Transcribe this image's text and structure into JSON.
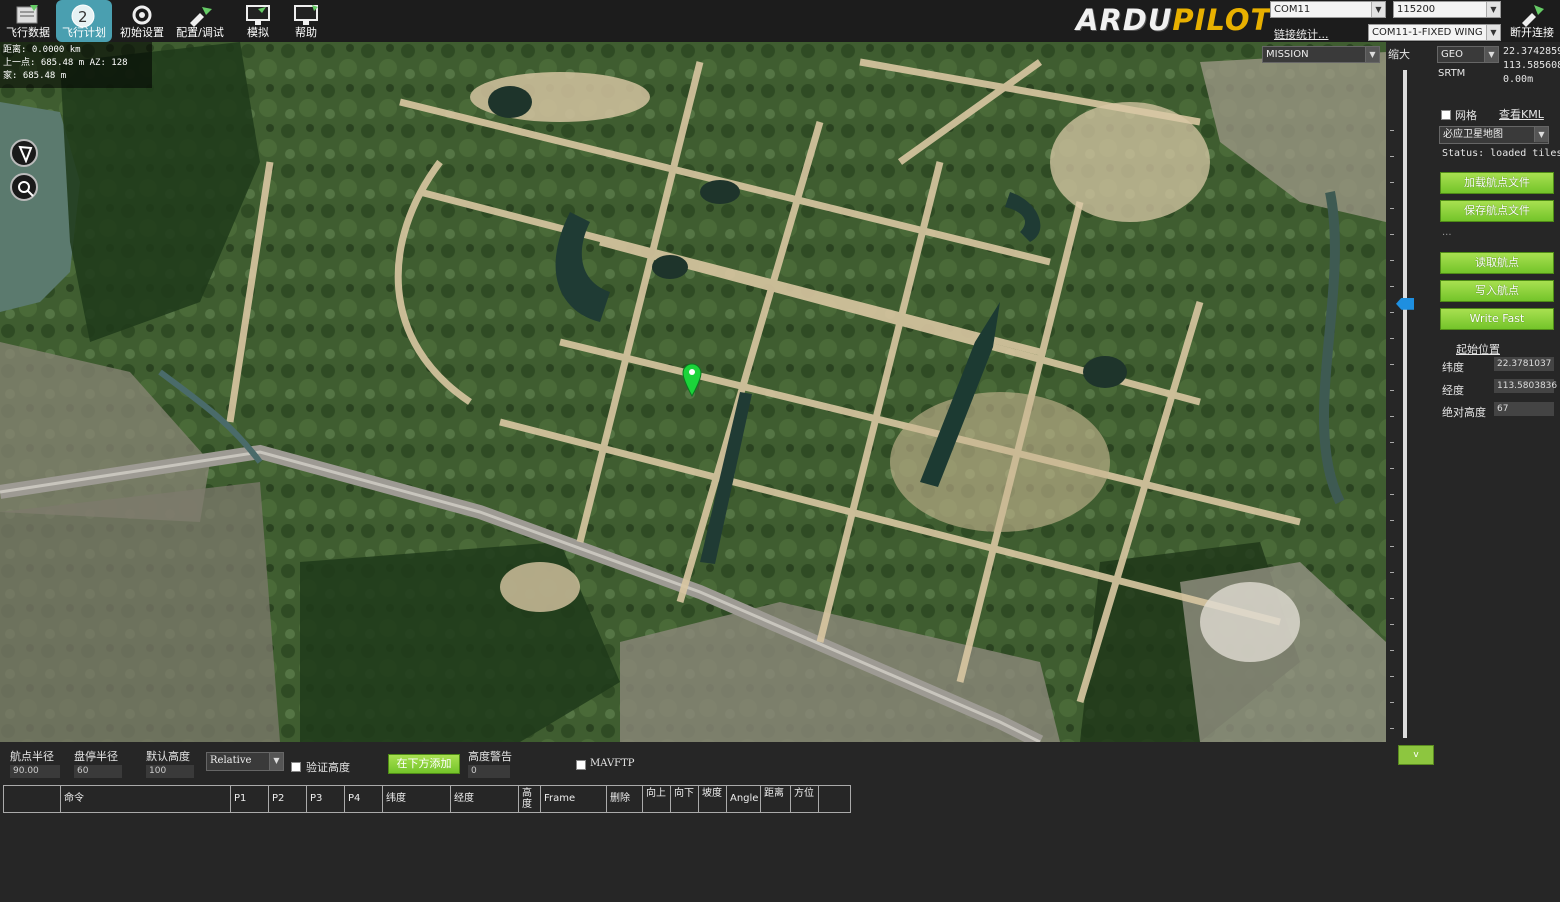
{
  "toolbar": {
    "buttons": [
      {
        "label": "飞行数据",
        "icon": "flight-data-icon"
      },
      {
        "label": "飞行计划",
        "icon": "flight-plan-icon",
        "active": true
      },
      {
        "label": "初始设置",
        "icon": "initial-setup-icon"
      },
      {
        "label": "配置/调试",
        "icon": "config-tuning-icon"
      },
      {
        "label": "模拟",
        "icon": "simulation-icon"
      },
      {
        "label": "帮助",
        "icon": "help-icon"
      }
    ],
    "logo_left": "ARDU",
    "logo_right": "PILOT",
    "port": "COM11",
    "baud": "115200",
    "link_stats": "链接统计...",
    "vehicle": "COM11-1-FIXED WING",
    "connect_label": "断开连接"
  },
  "map_overlay": {
    "distance": "距离: 0.0000 km",
    "prev_point": "上一点: 685.48 m AZ: 128",
    "home": "家: 685.48 m"
  },
  "map_marker": {
    "color": "#1bd43a"
  },
  "zoom": {
    "label": "缩大",
    "level": 0.35
  },
  "right_panel": {
    "mode": "MISSION",
    "coord_type": "GEO",
    "srtm": "SRTM",
    "lat": "22.3742859",
    "lng": "113.5856088",
    "alt": "0.00m",
    "grid_label": "网格",
    "view_kml": "查看KML",
    "map_provider": "必应卫星地图",
    "status": "Status: loaded tiles",
    "load_wp_file": "加载航点文件",
    "save_wp_file": "保存航点文件",
    "dots": "...",
    "read_wp": "读取航点",
    "write_wp": "写入航点",
    "write_fast": "Write Fast",
    "home_title": "起始位置",
    "home_lat_label": "纬度",
    "home_lat": "22.3781037",
    "home_lng_label": "经度",
    "home_lng": "113.5803836",
    "home_alt_label": "绝对高度",
    "home_alt": "67"
  },
  "bottom": {
    "wp_radius_label": "航点半径",
    "wp_radius": "90.00",
    "loiter_radius_label": "盘停半径",
    "loiter_radius": "60",
    "default_alt_label": "默认高度",
    "default_alt": "100",
    "alt_frame": "Relative",
    "verify_alt": "验证高度",
    "add_below": "在下方添加",
    "alt_warning_label": "高度警告",
    "alt_warning": "0",
    "mavftp": "MAVFTP",
    "zoom_down": "v"
  },
  "grid_columns": [
    "",
    "命令",
    "P1",
    "P2",
    "P3",
    "P4",
    "纬度",
    "经度",
    "高度",
    "Frame",
    "删除",
    "向上",
    "向下",
    "坡度",
    "Angle",
    "距离",
    "方位"
  ]
}
